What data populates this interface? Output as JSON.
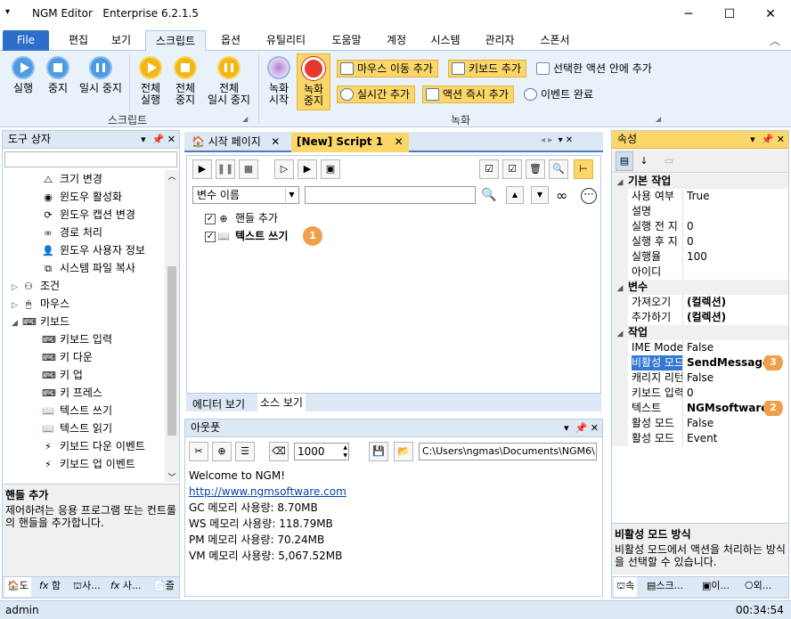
{
  "window": {
    "app_name": "NGM Editor",
    "edition": "Enterprise 6.2.1.5"
  },
  "ribbon_tabs": [
    "File",
    "편집",
    "보기",
    "스크립트",
    "옵션",
    "유틸리티",
    "도움말",
    "계정",
    "시스템",
    "관리자",
    "스폰서"
  ],
  "ribbon": {
    "script_group": {
      "label": "스크립트",
      "buttons": [
        "실행",
        "중지",
        "일시 중지"
      ],
      "all_buttons": [
        [
          "전체",
          "실행"
        ],
        [
          "전체",
          "중지"
        ],
        [
          "전체",
          "일시 중지"
        ]
      ]
    },
    "record_group": {
      "label": "녹화",
      "record_start": [
        "녹화",
        "시작"
      ],
      "record_stop": [
        "녹화",
        "중지"
      ],
      "small_buttons": [
        "마우스 이동 추가",
        "키보드 추가",
        "선택한 액션 안에 추가",
        "실시간 추가",
        "액션 즉시 추가",
        "이벤트 완료"
      ]
    }
  },
  "toolbox": {
    "title": "도구 상자",
    "items": [
      {
        "label": "크기 변경",
        "icon": "resize-icon",
        "indent": 2
      },
      {
        "label": "윈도우 활성화",
        "icon": "window-activate-icon",
        "indent": 2
      },
      {
        "label": "윈도우 캡션 변경",
        "icon": "caption-icon",
        "indent": 2
      },
      {
        "label": "경로 처리",
        "icon": "path-icon",
        "indent": 2
      },
      {
        "label": "윈도우 사용자 정보",
        "icon": "user-icon",
        "indent": 2
      },
      {
        "label": "시스템 파일 복사",
        "icon": "copy-icon",
        "indent": 2
      },
      {
        "label": "조건",
        "icon": "condition-icon",
        "indent": 1,
        "caret": "▷"
      },
      {
        "label": "마우스",
        "icon": "mouse-icon",
        "indent": 1,
        "caret": "▷"
      },
      {
        "label": "키보드",
        "icon": "keyboard-icon",
        "indent": 1,
        "caret": "◢"
      },
      {
        "label": "키보드 입력",
        "icon": "keyboard-icon",
        "indent": 2
      },
      {
        "label": "키 다운",
        "icon": "key-down-icon",
        "indent": 2
      },
      {
        "label": "키 업",
        "icon": "key-up-icon",
        "indent": 2
      },
      {
        "label": "키 프레스",
        "icon": "key-press-icon",
        "indent": 2
      },
      {
        "label": "텍스트 쓰기",
        "icon": "book-icon",
        "indent": 2
      },
      {
        "label": "텍스트 읽기",
        "icon": "book-icon",
        "indent": 2
      },
      {
        "label": "키보드 다운 이벤트",
        "icon": "lightning-icon",
        "indent": 2
      },
      {
        "label": "키보드 업 이벤트",
        "icon": "lightning-icon",
        "indent": 2
      }
    ],
    "description_title": "핸들 추가",
    "description_text": "제어하려는 응용 프로그램 또는 컨트롤의 핸들을 추가합니다.",
    "bottom_tabs": [
      "도",
      "함",
      "사...",
      "사...",
      "즐"
    ]
  },
  "editor": {
    "tabs": [
      "시작 페이지",
      "[New] Script 1"
    ],
    "variable_name": "변수 이름",
    "actions": [
      {
        "label": "핸들 추가",
        "bold": false
      },
      {
        "label": "텍스트 쓰기",
        "bold": true,
        "badge": "1"
      }
    ],
    "bottom_tabs": [
      "에디터 보기",
      "소스 보기"
    ]
  },
  "output": {
    "title": "아웃풋",
    "count_value": "1000",
    "path_value": "C:\\Users\\ngmas\\Documents\\NGM6\\",
    "lines": [
      {
        "text": "Welcome to NGM!",
        "link": false
      },
      {
        "text": "http://www.ngmsoftware.com",
        "link": true
      },
      {
        "text": "GC 메모리 사용량: 8.70MB",
        "link": false
      },
      {
        "text": "WS 메모리 사용량: 118.79MB",
        "link": false
      },
      {
        "text": "PM 메모리 사용량: 70.24MB",
        "link": false
      },
      {
        "text": "VM 메모리 사용량: 5,067.52MB",
        "link": false
      }
    ]
  },
  "properties": {
    "title": "속성",
    "rows": [
      {
        "type": "cat",
        "label": "기본 작업"
      },
      {
        "type": "prop",
        "name": "사용 여부",
        "value": "True"
      },
      {
        "type": "prop",
        "name": "설명",
        "value": ""
      },
      {
        "type": "prop",
        "name": "실행 전 지",
        "value": "0"
      },
      {
        "type": "prop",
        "name": "실행 후 지",
        "value": "0"
      },
      {
        "type": "prop",
        "name": "실행율",
        "value": "100"
      },
      {
        "type": "prop",
        "name": "아이디",
        "value": ""
      },
      {
        "type": "cat",
        "label": "변수"
      },
      {
        "type": "prop",
        "name": "가져오기",
        "value": "(컬렉션)",
        "bold": true
      },
      {
        "type": "prop",
        "name": "추가하기",
        "value": "(컬렉션)",
        "bold": true
      },
      {
        "type": "cat",
        "label": "작업"
      },
      {
        "type": "prop",
        "name": "IME Mode",
        "value": "False"
      },
      {
        "type": "prop",
        "name": "비활성 모드",
        "value": "SendMessage",
        "bold": true,
        "selected": true,
        "badge": "3"
      },
      {
        "type": "prop",
        "name": "캐리지 리턴",
        "value": "False"
      },
      {
        "type": "prop",
        "name": "키보드 입력",
        "value": "0"
      },
      {
        "type": "prop",
        "name": "텍스트",
        "value": "NGMsoftware",
        "bold": true,
        "badge": "2"
      },
      {
        "type": "prop",
        "name": "활성 모드",
        "value": "False"
      },
      {
        "type": "prop",
        "name": "활성 모드",
        "value": "Event"
      }
    ],
    "description_title": "비활성 모드 방식",
    "description_text": "비활성 모드에서 액션을 처리하는 방식을 선택할 수 있습니다.",
    "bottom_tabs": [
      "속",
      "스크...",
      "이...",
      "외..."
    ]
  },
  "statusbar": {
    "user": "admin",
    "time": "00:34:54"
  }
}
